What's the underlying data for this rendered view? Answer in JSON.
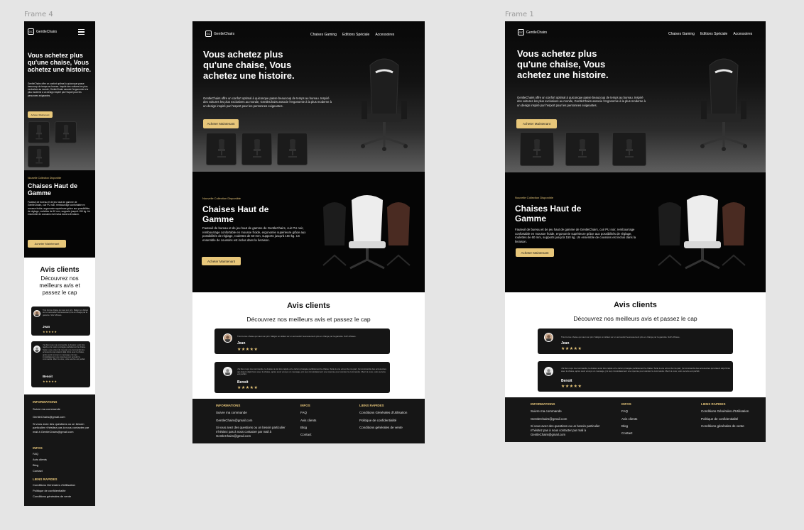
{
  "canvas": {
    "frame4_label": "Frame 4",
    "frame1_label": "Frame 1"
  },
  "brand": {
    "logo_mark": "GC",
    "name": "GentleChairs"
  },
  "nav": [
    "Chaises Gaming",
    "Editions Spéciale",
    "Accessoires"
  ],
  "hero": {
    "title": "Vous achetez plus qu'une chaise, Vous achetez une histoire.",
    "description": "GentleChairs offre un confort optimal à quiconque passe beaucoup de temps au bureau. Inspiré des voitures les plus exclusives au monde, GentleChairs associe l'ergonomie à la plus moderne à un design inspiré par l'esport pour les personnes exigeantes.",
    "button": "Acheter Maintenant"
  },
  "collection": {
    "tag": "Nouvelle Collection Disponible",
    "title": "Chaises Haut de Gamme",
    "description": "Fauteuil de bureau et de jeu haut de gamme de GentleChairs, cuir PU noir, rembourrage confortable en mousse froide, ergonomie supérieure grâce aux possibilités de réglage, roulettes de 60 mm, supports jusqu'à 150 kg. Un ensemble de coussins est inclus dans la livraison.",
    "button": "Acheter Maintenant"
  },
  "reviews": {
    "title": "Avis clients",
    "subtitle": "Découvrez nos meilleurs avis et passez le cap",
    "items": [
      {
        "text": "Très bonne chaise qui vaut son prix. Malgré un défaut sur un accoudoir heureusement pris en charge par la garantie. SAV efficace.",
        "name": "Jean",
        "stars": "★★★★★"
      },
      {
        "text": "J'ai bien reçu ma commande, le dossier a été très rapide et le carton protégée parfaitement la chaise. Suite à une erreur de ma part, j'ai commandé des accessoires qui étaient déjà livrés avec la chaise, après avoir envoyé un message, j'ai reçu immédiatement une réponse pour annuler la commande. Merci à vous, votre service est parfait.",
        "name": "Benoit",
        "stars": "★★★★★"
      }
    ]
  },
  "footer": {
    "informations": {
      "title": "INFORMATIONS",
      "items": [
        "Suivre ma commande",
        "GentleChairs@gmail.com",
        "Si vous avez des questions ou un besoin particulier n'hésitez pas à nous contacter par mail à GentleChairs@gmail.com"
      ]
    },
    "infos": {
      "title": "INFOS",
      "items": [
        "FAQ",
        "Avis clients",
        "Blog",
        "Contact"
      ]
    },
    "liens": {
      "title": "LIENS RAPIDES",
      "items": [
        "Conditions Générales d'Utilisation",
        "Politique de confidentialité",
        "Conditions générales de vente"
      ]
    }
  },
  "colors": {
    "accent": "#e8c77a",
    "background": "#0a0a0a",
    "canvas": "#e5e5e5"
  }
}
